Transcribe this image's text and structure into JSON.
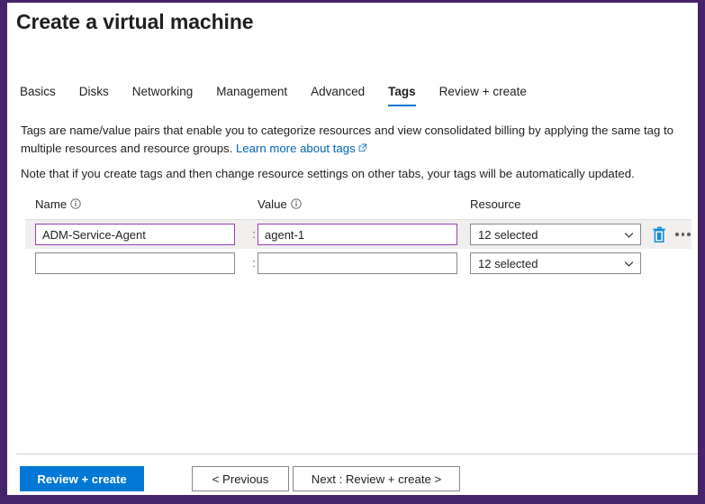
{
  "window": {
    "title": "Create a virtual machine",
    "frame_color": "#46236b"
  },
  "tabs": [
    {
      "label": "Basics",
      "selected": false
    },
    {
      "label": "Disks",
      "selected": false
    },
    {
      "label": "Networking",
      "selected": false
    },
    {
      "label": "Management",
      "selected": false
    },
    {
      "label": "Advanced",
      "selected": false
    },
    {
      "label": "Tags",
      "selected": true
    },
    {
      "label": "Review + create",
      "selected": false
    }
  ],
  "tab_accent_color": "#0078d4",
  "intro": {
    "text_before_link": "Tags are name/value pairs that enable you to categorize resources and view consolidated billing by applying the same tag to multiple resources and resource groups.",
    "link_label": "Learn more about tags",
    "link_icon": "external-link-icon"
  },
  "note": {
    "text": "Note that if you create tags and then change resource settings on other tabs, your tags will be automatically updated."
  },
  "table": {
    "columns": [
      {
        "label": "Name",
        "has_info_icon": true
      },
      {
        "label": "Value",
        "has_info_icon": true
      },
      {
        "label": "Resource",
        "has_info_icon": false
      }
    ],
    "separator": ":",
    "rows": [
      {
        "name_value": "ADM-Service-Agent",
        "name_placeholder": "",
        "value_value": "agent-1",
        "value_placeholder": "",
        "resource_label": "12 selected",
        "filled": true,
        "highlighted": true,
        "show_actions": true,
        "delete_icon": "trash-icon",
        "more_icon": "ellipsis-icon",
        "delete_icon_color": "#0f8ce0"
      },
      {
        "name_value": "",
        "name_placeholder": "",
        "value_value": "",
        "value_placeholder": "",
        "resource_label": "12 selected",
        "filled": false,
        "highlighted": false,
        "show_actions": false,
        "delete_icon": "",
        "more_icon": "",
        "delete_icon_color": ""
      }
    ]
  },
  "footer": {
    "review_create_label": "Review + create",
    "previous_label": "< Previous",
    "next_label": "Next : Review + create >",
    "primary_color": "#0078d4"
  }
}
